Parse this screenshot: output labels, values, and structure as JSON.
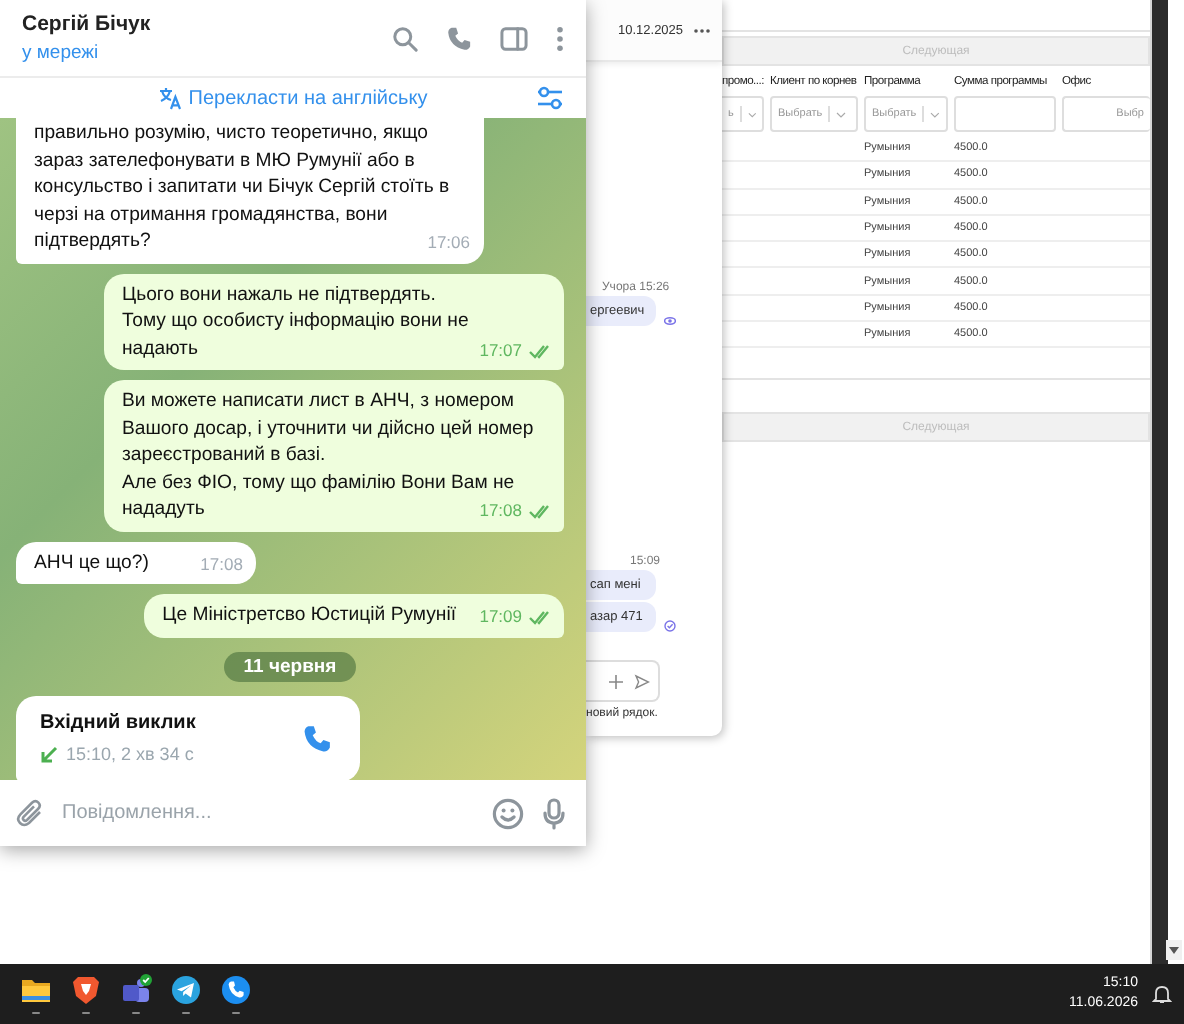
{
  "telegram": {
    "contact_name": "Сергій Бічук",
    "status": "у мережі",
    "translate_label": "Перекласти на англійську",
    "messages": [
      {
        "kind": "in",
        "text": "правильно розумію, чисто теоретично, якщо зараз зателефонувати в МЮ Румунії або в консульство і запитати чи Бічук Сергій стоїть в черзі на отримання громадянства, вони підтвердять?",
        "time": "17:06"
      },
      {
        "kind": "out",
        "text": "Цього вони нажаль не підтвердять.\nТому що особисту інформацію вони не надають",
        "time": "17:07",
        "read": true
      },
      {
        "kind": "out",
        "text": "Ви можете написати лист в АНЧ, з номером Вашого досар, і уточнити чи дійсно цей номер зареєстрований в базі.\nАле без ФІО, тому що фамілію Вони Вам не нададуть",
        "time": "17:08",
        "read": true
      },
      {
        "kind": "in",
        "text": "АНЧ це що?)",
        "time": "17:08"
      },
      {
        "kind": "out",
        "text": "Це Міністретсво Юстицій Румунії",
        "time": "17:09",
        "read": true
      },
      {
        "kind": "date",
        "text": "11 червня"
      },
      {
        "kind": "call",
        "title": "Вхідний виклик",
        "details": "15:10, 2 хв 34 с"
      }
    ],
    "composer": {
      "placeholder": "Повідомлення..."
    }
  },
  "side_chat": {
    "date": "10.12.2025",
    "first_time": "Учора 15:26",
    "first_bubble": "ергеевич",
    "second_time": "15:09",
    "bubbles": [
      "сап мені",
      "азар 471"
    ],
    "hint": "новий рядок."
  },
  "crm_table": {
    "pager_top": "Следующая",
    "columns": [
      "промо...:",
      "Клиент по корнев",
      "Программа",
      "Сумма программы",
      "Офис"
    ],
    "filters": [
      {
        "kind": "select",
        "value": "ь"
      },
      {
        "kind": "select",
        "value": "Выбрать"
      },
      {
        "kind": "select",
        "value": "Выбрать"
      },
      {
        "kind": "input"
      },
      {
        "kind": "input",
        "value": "Выбр"
      }
    ],
    "rows": [
      {
        "program": "Румыния",
        "amount": "4500.0"
      },
      {
        "program": "Румыния",
        "amount": "4500.0"
      },
      {
        "program": "Румыния",
        "amount": "4500.0"
      },
      {
        "program": "Румыния",
        "amount": "4500.0"
      },
      {
        "program": "Румыния",
        "amount": "4500.0"
      },
      {
        "program": "Румыния",
        "amount": "4500.0"
      },
      {
        "program": "Румыния",
        "amount": "4500.0"
      },
      {
        "program": "Румыния",
        "amount": "4500.0"
      }
    ],
    "pager_bottom": "Следующая"
  },
  "taskbar": {
    "apps": [
      {
        "kind": "folder"
      },
      {
        "kind": "shield"
      },
      {
        "kind": "teams"
      },
      {
        "kind": "telegram"
      },
      {
        "kind": "phone"
      }
    ],
    "clock": {
      "time": "15:10",
      "date": "11.06.2026"
    }
  }
}
